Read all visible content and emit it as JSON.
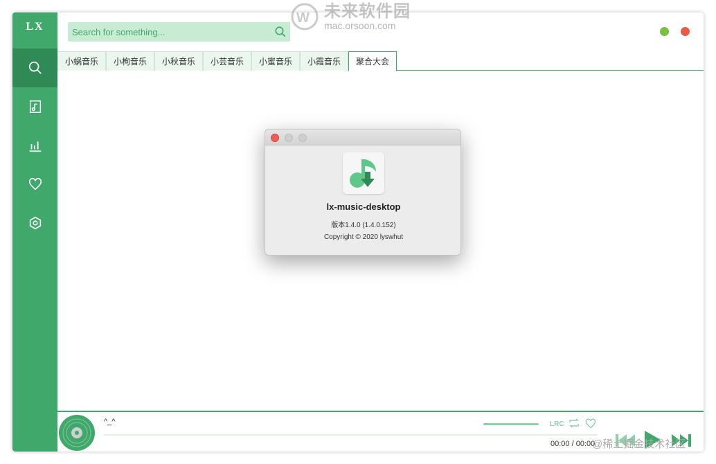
{
  "app": {
    "logo": "LX",
    "accent": "#3fa86a"
  },
  "sidebar": {
    "items": [
      {
        "name": "search",
        "icon": "search-icon"
      },
      {
        "name": "song-list",
        "icon": "music-file-icon"
      },
      {
        "name": "leaderboard",
        "icon": "bar-chart-icon"
      },
      {
        "name": "favorites",
        "icon": "heart-icon"
      },
      {
        "name": "settings",
        "icon": "settings-icon"
      }
    ]
  },
  "search": {
    "placeholder": "Search for something..."
  },
  "window_controls": {
    "minimize_color": "#77c044",
    "close_color": "#e85b45"
  },
  "tabs": [
    {
      "label": "小蜗音乐"
    },
    {
      "label": "小枸音乐"
    },
    {
      "label": "小秋音乐"
    },
    {
      "label": "小芸音乐"
    },
    {
      "label": "小蜜音乐"
    },
    {
      "label": "小霞音乐"
    },
    {
      "label": "聚合大会",
      "active": true
    }
  ],
  "player": {
    "song": "^_^",
    "current_time": "00:00",
    "separator": "/",
    "total_time": "00:00",
    "controls": {
      "lyric": "lrc-icon",
      "loop": "repeat-icon",
      "fav": "heart-icon",
      "prev": "prev-icon",
      "play": "play-icon",
      "next": "next-icon"
    }
  },
  "dialog": {
    "app_name": "lx-music-desktop",
    "version": "版本1.4.0 (1.4.0.152)",
    "copyright": "Copyright © 2020 lyswhut"
  },
  "watermark": {
    "title": "未来软件园",
    "url": "mac.orsoon.com"
  },
  "corner_brand": "@稀土掘金技术社区"
}
